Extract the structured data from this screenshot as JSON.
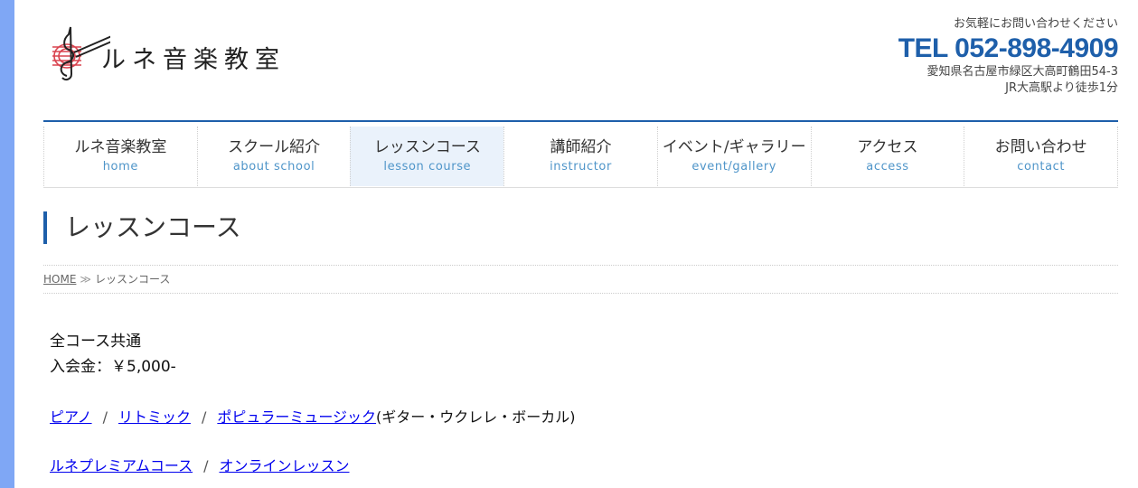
{
  "header": {
    "logo_text": "ルネ音楽教室",
    "contact_lead": "お気軽にお問い合わせください",
    "tel": "TEL 052-898-4909",
    "address": "愛知県名古屋市緑区大高町鶴田54-3",
    "access_note": "JR大高駅より徒歩1分"
  },
  "nav": {
    "items": [
      {
        "label": "ルネ音楽教室",
        "sub": "home"
      },
      {
        "label": "スクール紹介",
        "sub": "about school"
      },
      {
        "label": "レッスンコース",
        "sub": "lesson course"
      },
      {
        "label": "講師紹介",
        "sub": "instructor"
      },
      {
        "label": "イベント/ギャラリー",
        "sub": "event/gallery"
      },
      {
        "label": "アクセス",
        "sub": "access"
      },
      {
        "label": "お問い合わせ",
        "sub": "contact"
      }
    ]
  },
  "page": {
    "title": "レッスンコース"
  },
  "breadcrumb": {
    "home": "HOME",
    "separator": "≫",
    "current": "レッスンコース"
  },
  "content": {
    "all_course": "全コース共通",
    "entry_fee": "入会金：￥5,000-",
    "links_row1": {
      "piano": "ピアノ",
      "rhythmic": "リトミック",
      "popular": "ポピュラーミュージック",
      "popular_note": "(ギター・ウクレレ・ボーカル)"
    },
    "links_row2": {
      "premium": "ルネプレミアムコース",
      "online": "オンラインレッスン"
    },
    "slash": "/"
  },
  "colors": {
    "accent": "#1e5faa",
    "nav_sub": "#4f95c9",
    "side_bar": "#7fa7f5",
    "active_nav_bg": "#eaf2fb",
    "logo_treble_clef": "#d9434f"
  }
}
